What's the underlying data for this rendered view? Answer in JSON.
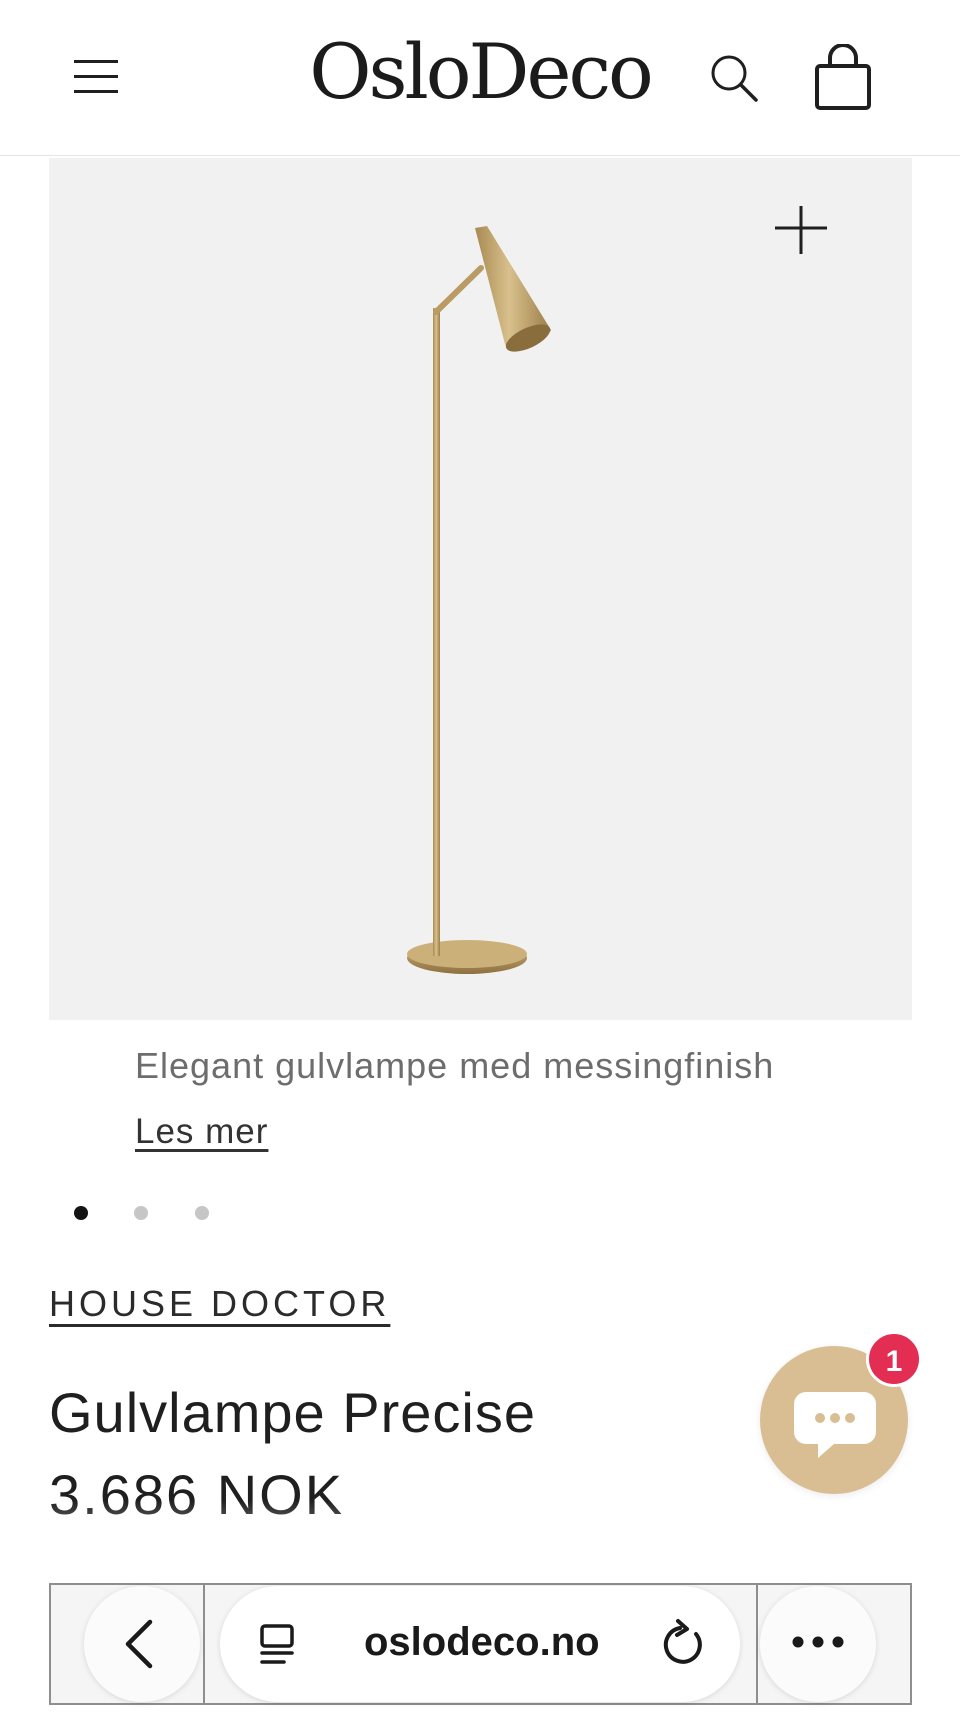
{
  "header": {
    "logo": "OsloDeco",
    "menu_icon": "hamburger-menu-icon",
    "search_icon": "search-icon",
    "cart_icon": "shopping-bag-icon"
  },
  "gallery": {
    "zoom_icon": "plus-icon",
    "caption": "Elegant gulvlampe med messingfinish",
    "read_more": "Les mer",
    "slides_total": 3,
    "active_slide": 1
  },
  "product": {
    "brand": "HOUSE DOCTOR",
    "title": "Gulvlampe Precise",
    "price": "3.686 NOK"
  },
  "chat": {
    "icon": "chat-bubble-icon",
    "badge_count": "1",
    "color": "#d9bd93",
    "badge_color": "#e32d52"
  },
  "browser": {
    "url": "oslodeco.no",
    "back_icon": "chevron-left-icon",
    "tabs_icon": "page-tabs-icon",
    "reload_icon": "reload-icon",
    "more_icon": "more-dots-icon"
  }
}
